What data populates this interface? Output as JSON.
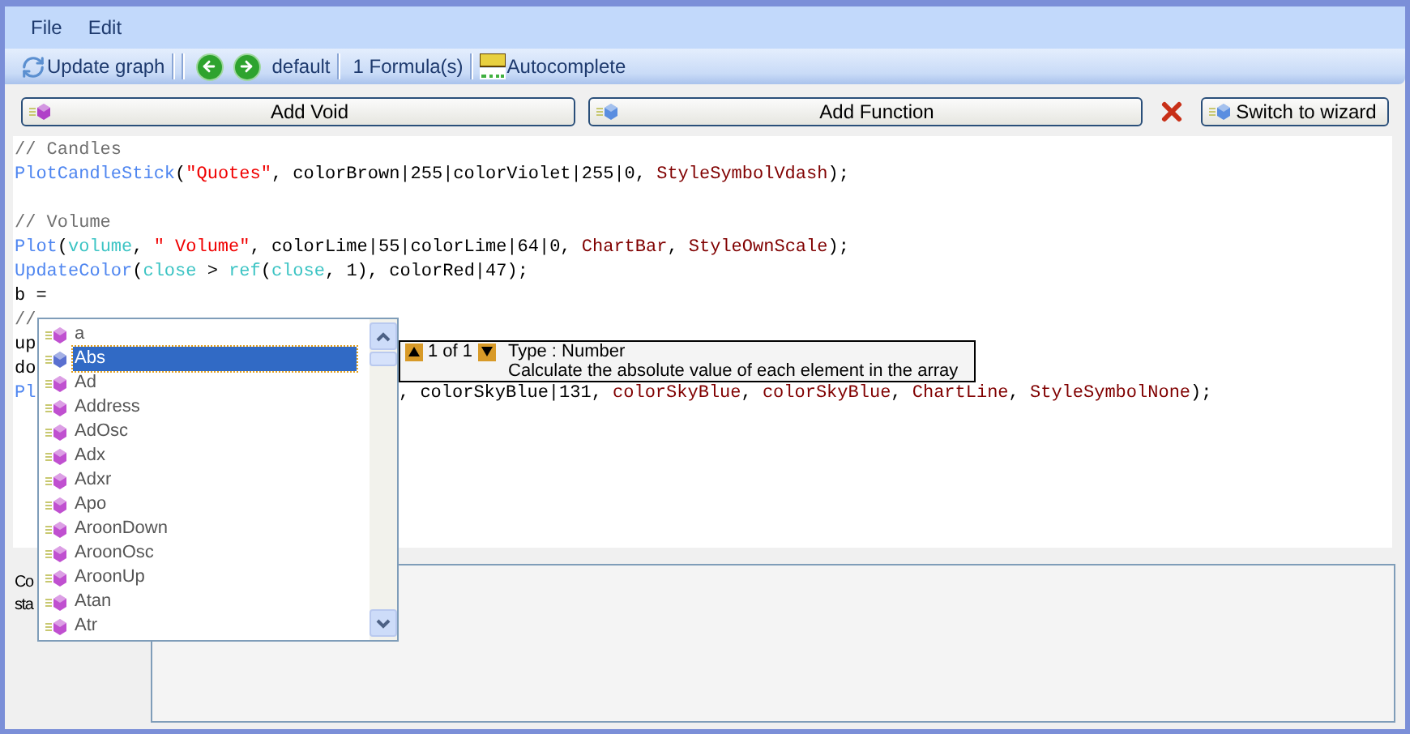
{
  "menu": [
    {
      "label": "File"
    },
    {
      "label": "Edit"
    }
  ],
  "toolbar": [
    {
      "kind": "refresh",
      "label": "Update graph"
    },
    {
      "kind": "separator"
    },
    {
      "kind": "separator"
    },
    {
      "kind": "back"
    },
    {
      "kind": "forward"
    },
    {
      "kind": "label",
      "label": "default"
    },
    {
      "kind": "separator"
    },
    {
      "kind": "label",
      "label": "1 Formula(s)"
    },
    {
      "kind": "separator"
    },
    {
      "kind": "plot",
      "label": "Autocomplete"
    }
  ],
  "actions": [
    {
      "kind": "void",
      "label": "Add Void"
    },
    {
      "kind": "function",
      "label": "Add Function"
    },
    {
      "kind": "delete"
    },
    {
      "kind": "wizard",
      "label": "Switch to wizard"
    }
  ],
  "code": [
    {
      "kind": "code",
      "tokens": [
        {
          "kind": "comment",
          "text": "// Candles"
        }
      ]
    },
    {
      "kind": "code",
      "tokens": [
        {
          "kind": "func",
          "text": "PlotCandleStick"
        },
        {
          "kind": "plain",
          "text": "("
        },
        {
          "kind": "string",
          "text": "\"Quotes\""
        },
        {
          "kind": "plain",
          "text": ", colorBrown|255|colorViolet|255|0, "
        },
        {
          "kind": "const",
          "text": "StyleSymbolVdash"
        },
        {
          "kind": "plain",
          "text": ");"
        }
      ]
    },
    {
      "kind": "blank"
    },
    {
      "kind": "code",
      "tokens": [
        {
          "kind": "comment",
          "text": "// Volume"
        }
      ]
    },
    {
      "kind": "code",
      "tokens": [
        {
          "kind": "func",
          "text": "Plot"
        },
        {
          "kind": "plain",
          "text": "("
        },
        {
          "kind": "var",
          "text": "volume"
        },
        {
          "kind": "plain",
          "text": ", "
        },
        {
          "kind": "string",
          "text": "\" Volume\""
        },
        {
          "kind": "plain",
          "text": ", colorLime|55|colorLime|64|0, "
        },
        {
          "kind": "const",
          "text": "ChartBar"
        },
        {
          "kind": "plain",
          "text": ", "
        },
        {
          "kind": "const",
          "text": "StyleOwnScale"
        },
        {
          "kind": "plain",
          "text": ");"
        }
      ]
    },
    {
      "kind": "code",
      "tokens": [
        {
          "kind": "func",
          "text": "UpdateColor"
        },
        {
          "kind": "plain",
          "text": "("
        },
        {
          "kind": "var",
          "text": "close"
        },
        {
          "kind": "plain",
          "text": " > "
        },
        {
          "kind": "var",
          "text": "ref"
        },
        {
          "kind": "plain",
          "text": "("
        },
        {
          "kind": "var",
          "text": "close"
        },
        {
          "kind": "plain",
          "text": ", 1), colorRed|47);"
        }
      ]
    },
    {
      "kind": "code",
      "tokens": [
        {
          "kind": "plain",
          "text": "b ="
        }
      ]
    },
    {
      "kind": "code",
      "tokens": [
        {
          "kind": "comment",
          "text": "//"
        }
      ]
    },
    {
      "kind": "code",
      "tokens": [
        {
          "kind": "plain",
          "text": "up"
        }
      ]
    },
    {
      "kind": "code",
      "tokens": [
        {
          "kind": "plain",
          "text": "do"
        }
      ]
    },
    {
      "kind": "code",
      "tokens": [
        {
          "kind": "func",
          "text": "Pl"
        }
      ],
      "tail": [
        {
          "kind": "plain",
          "text": ", colorSkyBlue|131, "
        },
        {
          "kind": "const",
          "text": "colorSkyBlue"
        },
        {
          "kind": "plain",
          "text": ", "
        },
        {
          "kind": "const",
          "text": "colorSkyBlue"
        },
        {
          "kind": "plain",
          "text": ", "
        },
        {
          "kind": "const",
          "text": "ChartLine"
        },
        {
          "kind": "plain",
          "text": ", "
        },
        {
          "kind": "const",
          "text": "StyleSymbolNone"
        },
        {
          "kind": "plain",
          "text": ");"
        }
      ]
    }
  ],
  "autocomplete": {
    "items": [
      {
        "label": "a",
        "selected": false
      },
      {
        "label": "Abs",
        "selected": true
      },
      {
        "label": "Ad",
        "selected": false
      },
      {
        "label": "Address",
        "selected": false
      },
      {
        "label": "AdOsc",
        "selected": false
      },
      {
        "label": "Adx",
        "selected": false
      },
      {
        "label": "Adxr",
        "selected": false
      },
      {
        "label": "Apo",
        "selected": false
      },
      {
        "label": "AroonDown",
        "selected": false
      },
      {
        "label": "AroonOsc",
        "selected": false
      },
      {
        "label": "AroonUp",
        "selected": false
      },
      {
        "label": "Atan",
        "selected": false
      },
      {
        "label": "Atr",
        "selected": false
      }
    ]
  },
  "tooltip": {
    "counter": "1 of 1",
    "type": "Type : Number",
    "description": "Calculate the absolute value of each element in the array"
  },
  "status_labels": [
    "Co",
    "sta"
  ]
}
